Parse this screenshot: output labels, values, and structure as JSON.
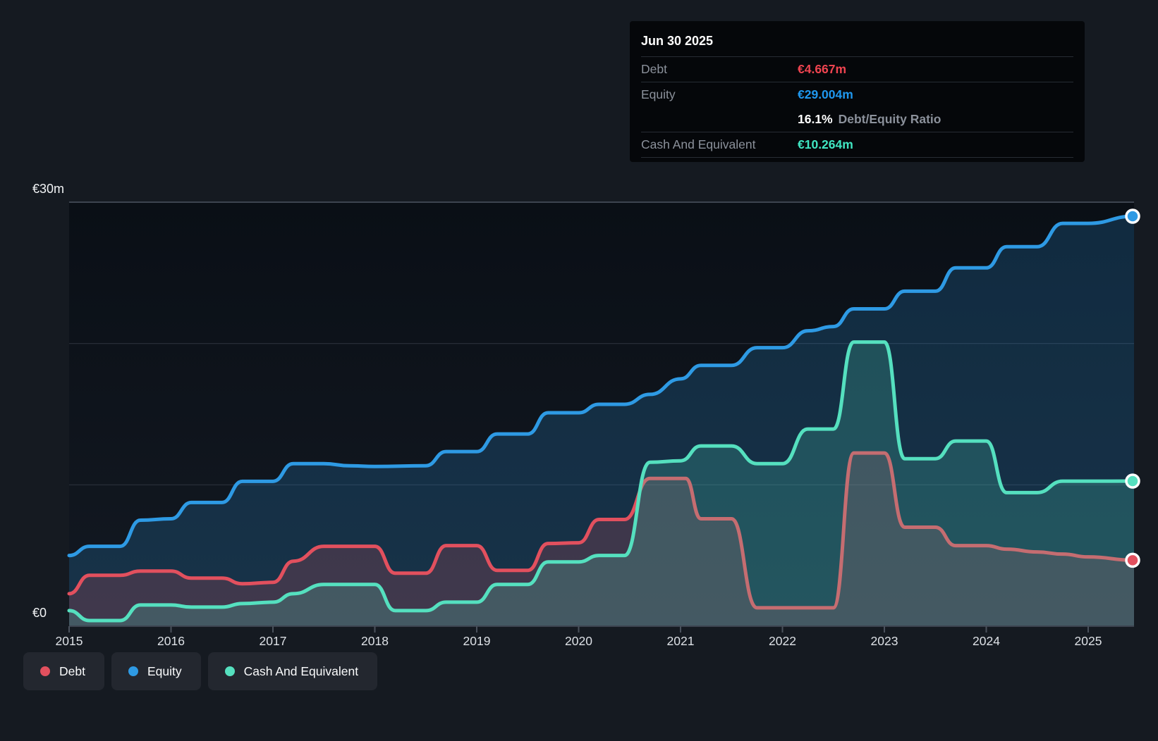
{
  "page": {
    "background": "#151a21"
  },
  "tooltip": {
    "title": "Jun 30 2025",
    "rows": {
      "debt": {
        "label": "Debt",
        "value": "€4.667m",
        "color": "#ef4450"
      },
      "equity": {
        "label": "Equity",
        "value": "€29.004m",
        "color": "#1f97ee"
      },
      "ratio": {
        "value": "16.1%",
        "label": "Debt/Equity Ratio"
      },
      "cash": {
        "label": "Cash And Equivalent",
        "value": "€10.264m",
        "color": "#40e6c2"
      }
    }
  },
  "legend": {
    "items": [
      {
        "label": "Debt",
        "color": "#e2505e"
      },
      {
        "label": "Equity",
        "color": "#2e9ae4"
      },
      {
        "label": "Cash And Equivalent",
        "color": "#55e0bf"
      }
    ]
  },
  "chart_data": {
    "type": "area",
    "title": "",
    "xlabel": "",
    "ylabel": "",
    "x_ticks": [
      2015,
      2016,
      2017,
      2018,
      2019,
      2020,
      2021,
      2022,
      2023,
      2024,
      2025
    ],
    "x_range": [
      2015.0,
      2025.45
    ],
    "y_axis": {
      "unit": "€m",
      "range": [
        0,
        30
      ],
      "gridline_values": [
        30,
        20,
        10,
        0
      ],
      "labels": [
        {
          "value": 30,
          "text": "€30m"
        },
        {
          "value": 0,
          "text": "€0"
        }
      ]
    },
    "legend_position": "bottom-left",
    "grid": true,
    "paint_order": [
      "Equity",
      "Debt",
      "Cash And Equivalent"
    ],
    "hover_point": {
      "date": "Jun 30 2025",
      "debt_m": 4.667,
      "equity_m": 29.004,
      "debt_equity_ratio_pct": 16.1,
      "cash_m": 10.264
    },
    "series": [
      {
        "name": "Debt",
        "color": "#e2505e",
        "fill": "rgba(225,79,94,0.20)",
        "points": [
          [
            2015.0,
            2.3
          ],
          [
            2015.2,
            3.6
          ],
          [
            2015.5,
            3.6
          ],
          [
            2015.7,
            3.9
          ],
          [
            2016.0,
            3.9
          ],
          [
            2016.2,
            3.4
          ],
          [
            2016.5,
            3.4
          ],
          [
            2016.7,
            3.0
          ],
          [
            2017.0,
            3.1
          ],
          [
            2017.2,
            4.6
          ],
          [
            2017.5,
            5.65
          ],
          [
            2018.0,
            5.65
          ],
          [
            2018.2,
            3.75
          ],
          [
            2018.5,
            3.75
          ],
          [
            2018.7,
            5.7
          ],
          [
            2019.0,
            5.7
          ],
          [
            2019.2,
            3.95
          ],
          [
            2019.5,
            3.95
          ],
          [
            2019.7,
            5.85
          ],
          [
            2020.0,
            5.9
          ],
          [
            2020.2,
            7.55
          ],
          [
            2020.45,
            7.55
          ],
          [
            2020.7,
            10.45
          ],
          [
            2021.05,
            10.45
          ],
          [
            2021.2,
            7.6
          ],
          [
            2021.5,
            7.6
          ],
          [
            2021.75,
            1.3
          ],
          [
            2022.0,
            1.3
          ],
          [
            2022.5,
            1.3
          ],
          [
            2022.7,
            12.25
          ],
          [
            2023.0,
            12.25
          ],
          [
            2023.2,
            7.0
          ],
          [
            2023.5,
            7.0
          ],
          [
            2023.7,
            5.7
          ],
          [
            2024.0,
            5.7
          ],
          [
            2024.2,
            5.45
          ],
          [
            2024.5,
            5.25
          ],
          [
            2024.75,
            5.1
          ],
          [
            2025.0,
            4.9
          ],
          [
            2025.45,
            4.667
          ]
        ]
      },
      {
        "name": "Equity",
        "color": "#2e9ae4",
        "fill": "rgba(46,154,228,0.20)",
        "points": [
          [
            2015.0,
            5.0
          ],
          [
            2015.2,
            5.65
          ],
          [
            2015.5,
            5.65
          ],
          [
            2015.7,
            7.5
          ],
          [
            2016.0,
            7.6
          ],
          [
            2016.2,
            8.75
          ],
          [
            2016.5,
            8.75
          ],
          [
            2016.7,
            10.25
          ],
          [
            2017.0,
            10.25
          ],
          [
            2017.2,
            11.5
          ],
          [
            2017.5,
            11.5
          ],
          [
            2017.75,
            11.35
          ],
          [
            2018.0,
            11.3
          ],
          [
            2018.5,
            11.35
          ],
          [
            2018.7,
            12.35
          ],
          [
            2019.0,
            12.35
          ],
          [
            2019.2,
            13.6
          ],
          [
            2019.5,
            13.6
          ],
          [
            2019.7,
            15.1
          ],
          [
            2020.0,
            15.1
          ],
          [
            2020.2,
            15.7
          ],
          [
            2020.45,
            15.7
          ],
          [
            2020.7,
            16.4
          ],
          [
            2021.0,
            17.5
          ],
          [
            2021.2,
            18.45
          ],
          [
            2021.5,
            18.45
          ],
          [
            2021.75,
            19.7
          ],
          [
            2022.0,
            19.7
          ],
          [
            2022.25,
            20.9
          ],
          [
            2022.5,
            21.2
          ],
          [
            2022.7,
            22.45
          ],
          [
            2023.0,
            22.45
          ],
          [
            2023.2,
            23.7
          ],
          [
            2023.5,
            23.7
          ],
          [
            2023.7,
            25.35
          ],
          [
            2024.0,
            25.35
          ],
          [
            2024.2,
            26.85
          ],
          [
            2024.5,
            26.85
          ],
          [
            2024.75,
            28.5
          ],
          [
            2025.0,
            28.5
          ],
          [
            2025.45,
            29.004
          ]
        ]
      },
      {
        "name": "Cash And Equivalent",
        "color": "#55e0bf",
        "fill": "rgba(85,224,191,0.20)",
        "points": [
          [
            2015.0,
            1.1
          ],
          [
            2015.2,
            0.4
          ],
          [
            2015.5,
            0.4
          ],
          [
            2015.7,
            1.5
          ],
          [
            2016.0,
            1.5
          ],
          [
            2016.2,
            1.35
          ],
          [
            2016.5,
            1.35
          ],
          [
            2016.7,
            1.6
          ],
          [
            2017.0,
            1.7
          ],
          [
            2017.2,
            2.3
          ],
          [
            2017.5,
            2.95
          ],
          [
            2018.0,
            2.95
          ],
          [
            2018.2,
            1.1
          ],
          [
            2018.5,
            1.1
          ],
          [
            2018.7,
            1.7
          ],
          [
            2019.0,
            1.7
          ],
          [
            2019.2,
            2.95
          ],
          [
            2019.5,
            2.95
          ],
          [
            2019.7,
            4.55
          ],
          [
            2020.0,
            4.55
          ],
          [
            2020.2,
            5.0
          ],
          [
            2020.45,
            5.0
          ],
          [
            2020.7,
            11.6
          ],
          [
            2021.0,
            11.7
          ],
          [
            2021.2,
            12.75
          ],
          [
            2021.5,
            12.75
          ],
          [
            2021.75,
            11.5
          ],
          [
            2022.0,
            11.5
          ],
          [
            2022.25,
            13.95
          ],
          [
            2022.5,
            13.95
          ],
          [
            2022.7,
            20.1
          ],
          [
            2023.0,
            20.1
          ],
          [
            2023.2,
            11.85
          ],
          [
            2023.5,
            11.85
          ],
          [
            2023.7,
            13.1
          ],
          [
            2024.0,
            13.1
          ],
          [
            2024.2,
            9.45
          ],
          [
            2024.5,
            9.45
          ],
          [
            2024.75,
            10.26
          ],
          [
            2025.0,
            10.26
          ],
          [
            2025.45,
            10.264
          ]
        ]
      }
    ]
  }
}
